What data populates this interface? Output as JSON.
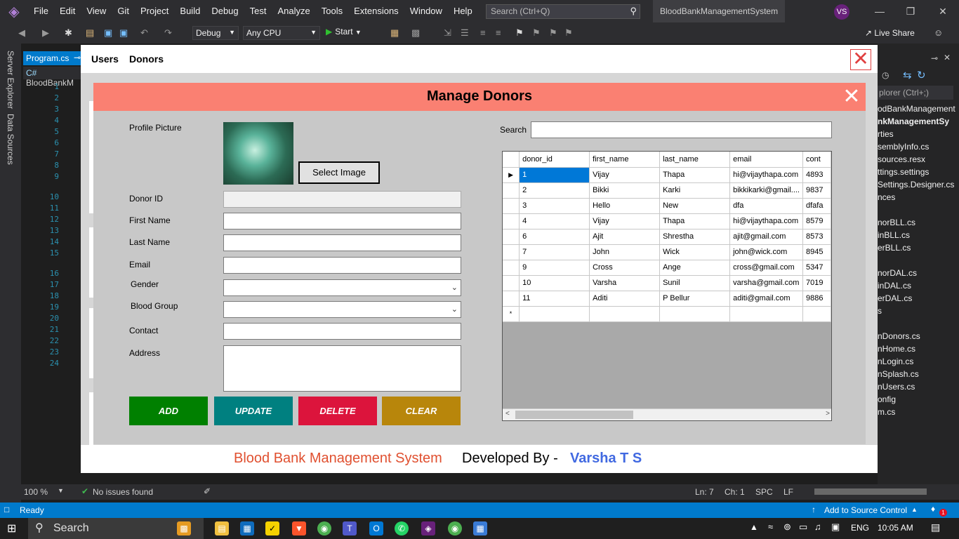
{
  "vs": {
    "menu": [
      "File",
      "Edit",
      "View",
      "Git",
      "Project",
      "Build",
      "Debug",
      "Test",
      "Analyze",
      "Tools",
      "Extensions",
      "Window",
      "Help"
    ],
    "search_placeholder": "Search (Ctrl+Q)",
    "solution_title": "BloodBankManagementSystem",
    "avatar": "VS",
    "config": "Debug",
    "platform": "Any CPU",
    "start": "Start",
    "live_share": "Live Share",
    "tab": "Program.cs",
    "nav": "BloodBankM",
    "server_explorer": "Server Explorer",
    "data_sources": "Data Sources",
    "line_numbers": [
      "1",
      "2",
      "3",
      "4",
      "5",
      "6",
      "7",
      "8",
      "9",
      "10",
      "11",
      "12",
      "13",
      "14",
      "15",
      "16",
      "17",
      "18",
      "19",
      "20",
      "21",
      "22",
      "23",
      "24"
    ],
    "solution_search": "plorer (Ctrl+;)",
    "solution_items": [
      "odBankManagement",
      "nkManagementSy",
      "rties",
      "semblyInfo.cs",
      "sources.resx",
      "ttings.settings",
      "Settings.Designer.cs",
      "nces",
      "norBLL.cs",
      "inBLL.cs",
      "erBLL.cs",
      "norDAL.cs",
      "inDAL.cs",
      "erDAL.cs",
      "s",
      "nDonors.cs",
      "nHome.cs",
      "nLogin.cs",
      "nSplash.cs",
      "nUsers.cs",
      "onfig",
      "m.cs"
    ],
    "zoom": "100 %",
    "issues": "No issues found",
    "ln": "Ln: 7",
    "ch": "Ch: 1",
    "spc": "SPC",
    "lf": "LF",
    "status_ready": "Ready",
    "source_control": "Add to Source Control",
    "notifications": "1"
  },
  "taskbar": {
    "search": "Search",
    "lang": "ENG",
    "time": "10:05 AM"
  },
  "app": {
    "menu_users": "Users",
    "menu_donors": "Donors",
    "footer_system": "Blood Bank Management System",
    "footer_dev": "Developed By -",
    "footer_name": "Varsha T S",
    "form": {
      "title": "Manage Donors",
      "labels": {
        "profile": "Profile Picture",
        "donor_id": "Donor ID",
        "first_name": "First Name",
        "last_name": "Last Name",
        "email": "Email",
        "gender": "Gender",
        "blood_group": "Blood Group",
        "contact": "Contact",
        "address": "Address",
        "search": "Search"
      },
      "select_image": "Select Image",
      "buttons": {
        "add": "ADD",
        "update": "UPDATE",
        "delete": "DELETE",
        "clear": "CLEAR"
      },
      "colors": {
        "header": "#fa8072",
        "add": "#008000",
        "update": "#008080",
        "delete": "#dc143c",
        "clear": "#b8860b"
      }
    },
    "grid": {
      "columns": [
        "donor_id",
        "first_name",
        "last_name",
        "email",
        "cont"
      ],
      "rows": [
        [
          "1",
          "Vijay",
          "Thapa",
          "hi@vijaythapa.com",
          "4893"
        ],
        [
          "2",
          "Bikki",
          "Karki",
          "bikkikarki@gmail....",
          "9837"
        ],
        [
          "3",
          "Hello",
          "New",
          "dfa",
          "dfafa"
        ],
        [
          "4",
          "Vijay",
          "Thapa",
          "hi@vijaythapa.com",
          "8579"
        ],
        [
          "6",
          "Ajit",
          "Shrestha",
          "ajit@gmail.com",
          "8573"
        ],
        [
          "7",
          "John",
          "Wick",
          "john@wick.com",
          "8945"
        ],
        [
          "9",
          "Cross",
          "Ange",
          "cross@gmail.com",
          "5347"
        ],
        [
          "10",
          "Varsha",
          "Sunil",
          "varsha@gmail.com",
          "7019"
        ],
        [
          "11",
          "Aditi",
          "P Bellur",
          "aditi@gmail.com",
          "9886"
        ]
      ]
    }
  }
}
